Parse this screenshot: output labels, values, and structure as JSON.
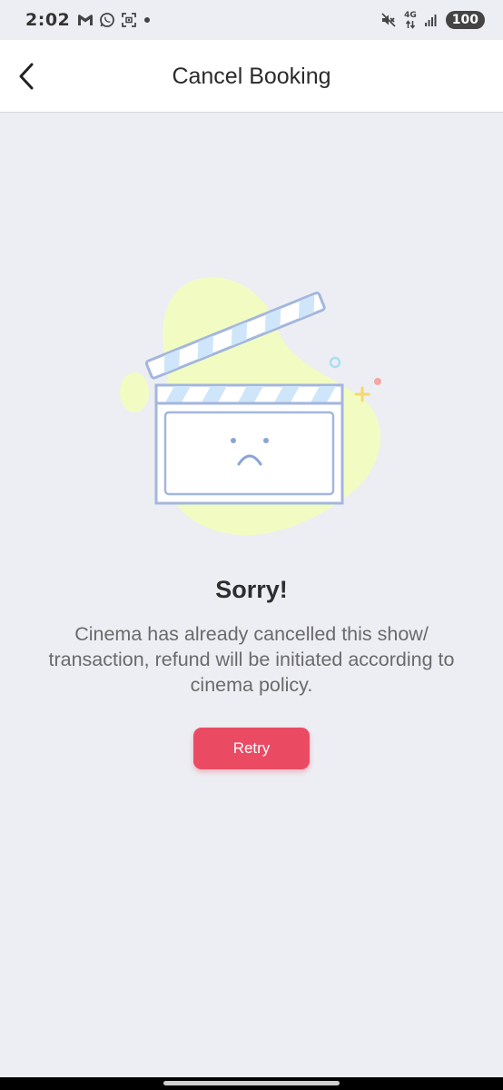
{
  "status_bar": {
    "time": "2:02",
    "network_type": "4G",
    "battery_level": "100",
    "icons": [
      "gmail-icon",
      "whatsapp-icon",
      "screenshot-icon",
      "notification-dot-icon",
      "mute-icon",
      "network-4g-icon",
      "signal-icon",
      "battery-icon"
    ]
  },
  "header": {
    "title": "Cancel Booking",
    "back_icon": "chevron-left-icon"
  },
  "illustration": {
    "icon": "sad-clapperboard-icon",
    "colors": {
      "blob": "#f2fcc2",
      "outline": "#a3b6de",
      "stripe": "#cfe6fa",
      "face": "#8aa5d6",
      "sparkle_pink": "#f4a6a6",
      "sparkle_yellow": "#f7d96b",
      "sparkle_blue": "#a8dff2"
    }
  },
  "content": {
    "heading": "Sorry!",
    "message": "Cinema has already cancelled this show/ transaction, refund will be initiated according to cinema policy."
  },
  "actions": {
    "retry_label": "Retry"
  },
  "colors": {
    "background": "#eceef3",
    "accent": "#ea4b63",
    "header_bg": "#ffffff"
  }
}
